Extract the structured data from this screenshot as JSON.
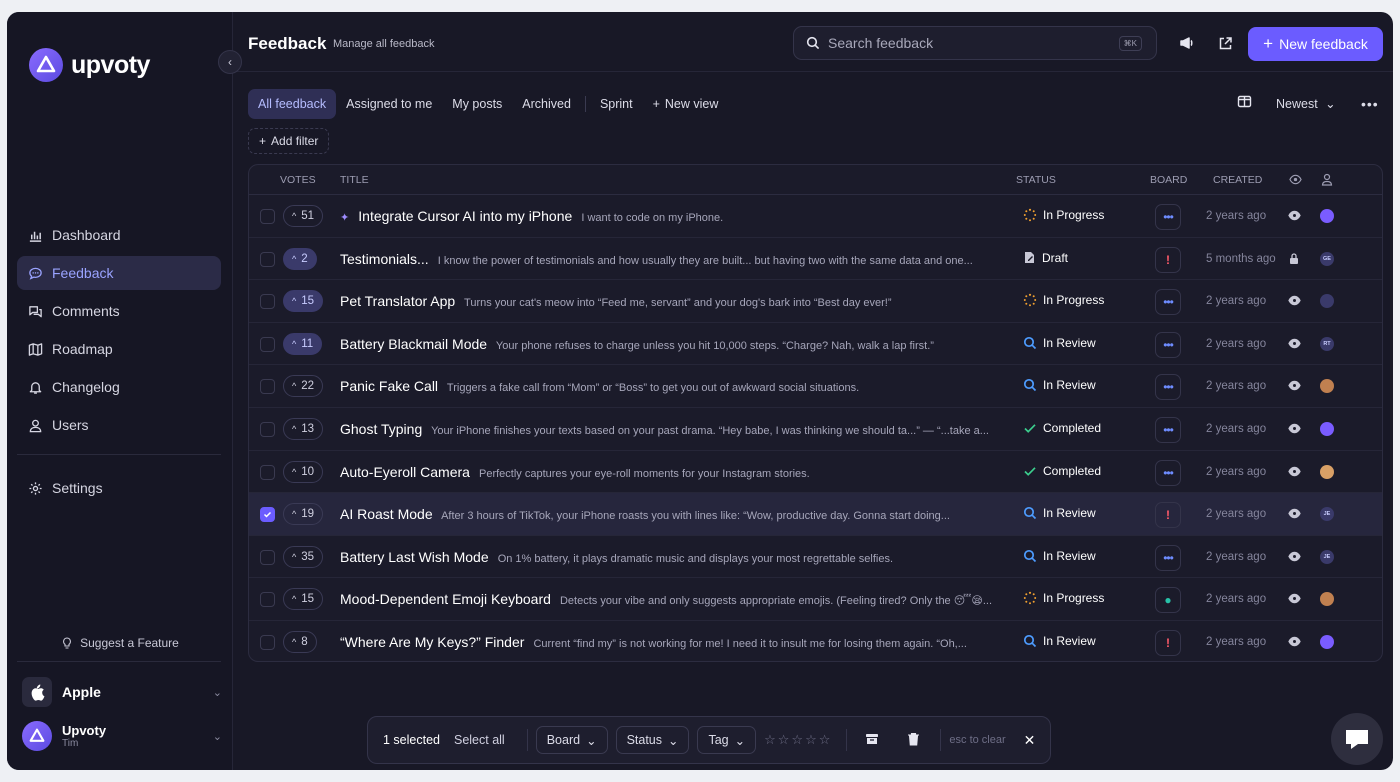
{
  "app": {
    "logo": "upvoty"
  },
  "sidebar": {
    "items": [
      {
        "label": "Dashboard",
        "icon": "bar-chart-icon",
        "active": false
      },
      {
        "label": "Feedback",
        "icon": "chat-bubble-icon",
        "active": true
      },
      {
        "label": "Comments",
        "icon": "comments-icon",
        "active": false
      },
      {
        "label": "Roadmap",
        "icon": "map-icon",
        "active": false
      },
      {
        "label": "Changelog",
        "icon": "bell-icon",
        "active": false
      },
      {
        "label": "Users",
        "icon": "user-icon",
        "active": false
      }
    ],
    "settings": "Settings",
    "suggest": "Suggest a Feature",
    "workspace": "Apple",
    "user_name": "Upvoty",
    "user_sub": "Tim"
  },
  "header": {
    "title": "Feedback",
    "subtitle": "Manage all feedback",
    "search_placeholder": "Search feedback",
    "search_shortcut": "⌘K",
    "new_button": "New feedback",
    "accent": "#6b5cff"
  },
  "tabs": [
    "All feedback",
    "Assigned to me",
    "My posts",
    "Archived",
    "Sprint",
    "New view"
  ],
  "sort_label": "Newest",
  "add_filter": "Add filter",
  "columns": {
    "votes": "VOTES",
    "title": "TITLE",
    "status": "STATUS",
    "board": "BOARD",
    "created": "CREATED"
  },
  "rows": [
    {
      "votes": "51",
      "filled": false,
      "pinned": true,
      "title": "Integrate Cursor AI into my iPhone",
      "desc": "I want to code on my iPhone.",
      "status": "In Progress",
      "status_icon": "progress-icon",
      "board": "dots",
      "created": "2 years ago",
      "vis": "eye-icon",
      "avatar": "",
      "selected": false
    },
    {
      "votes": "2",
      "filled": true,
      "pinned": false,
      "title": "Testimonials...",
      "desc": "I know the power of testimonials and how usually they are built... but having two with the same data and one...",
      "status": "Draft",
      "status_icon": "draft-icon",
      "board": "alert",
      "created": "5 months ago",
      "vis": "lock-icon",
      "avatar": "GE",
      "selected": false
    },
    {
      "votes": "15",
      "filled": true,
      "pinned": false,
      "title": "Pet Translator App",
      "desc": "Turns your cat's meow into “Feed me, servant” and your dog's bark into “Best day ever!”",
      "status": "In Progress",
      "status_icon": "progress-icon",
      "board": "dots",
      "created": "2 years ago",
      "vis": "eye-icon",
      "avatar": "",
      "selected": false
    },
    {
      "votes": "11",
      "filled": true,
      "pinned": false,
      "title": "Battery Blackmail Mode",
      "desc": "Your phone refuses to charge unless you hit 10,000 steps. “Charge? Nah, walk a lap first.”",
      "status": "In Review",
      "status_icon": "search-icon",
      "board": "dots",
      "created": "2 years ago",
      "vis": "eye-icon",
      "avatar": "RT",
      "selected": false
    },
    {
      "votes": "22",
      "filled": false,
      "pinned": false,
      "title": "Panic Fake Call",
      "desc": "Triggers a fake call from “Mom” or “Boss” to get you out of awkward social situations.",
      "status": "In Review",
      "status_icon": "search-icon",
      "board": "dots",
      "created": "2 years ago",
      "vis": "eye-icon",
      "avatar": "",
      "selected": false
    },
    {
      "votes": "13",
      "filled": false,
      "pinned": false,
      "title": "Ghost Typing",
      "desc": "Your iPhone finishes your texts based on your past drama. “Hey babe, I was thinking we should ta...” — “...take a...",
      "status": "Completed",
      "status_icon": "check-icon",
      "board": "dots",
      "created": "2 years ago",
      "vis": "eye-icon",
      "avatar": "",
      "selected": false
    },
    {
      "votes": "10",
      "filled": false,
      "pinned": false,
      "title": "Auto-Eyeroll Camera",
      "desc": "Perfectly captures your eye-roll moments for your Instagram stories.",
      "status": "Completed",
      "status_icon": "check-icon",
      "board": "dots",
      "created": "2 years ago",
      "vis": "eye-icon",
      "avatar": "",
      "selected": false
    },
    {
      "votes": "19",
      "filled": false,
      "pinned": false,
      "title": "AI Roast Mode",
      "desc": "After 3 hours of TikTok, your iPhone roasts you with lines like: “Wow, productive day. Gonna start doing...",
      "status": "In Review",
      "status_icon": "search-icon",
      "board": "alert",
      "created": "2 years ago",
      "vis": "eye-icon",
      "avatar": "JE",
      "selected": true
    },
    {
      "votes": "35",
      "filled": false,
      "pinned": false,
      "title": "Battery Last Wish Mode",
      "desc": "On 1% battery, it plays dramatic music and displays your most regrettable selfies.",
      "status": "In Review",
      "status_icon": "search-icon",
      "board": "dots",
      "created": "2 years ago",
      "vis": "eye-icon",
      "avatar": "JE",
      "selected": false
    },
    {
      "votes": "15",
      "filled": false,
      "pinned": false,
      "title": "Mood-Dependent Emoji Keyboard",
      "desc": "Detects your vibe and only suggests appropriate emojis. (Feeling tired? Only the 😴😪...",
      "status": "In Progress",
      "status_icon": "progress-icon",
      "board": "bulb",
      "created": "2 years ago",
      "vis": "eye-icon",
      "avatar": "",
      "selected": false
    },
    {
      "votes": "8",
      "filled": false,
      "pinned": false,
      "title": "“Where Are My Keys?” Finder",
      "desc": "Current “find my” is not working for me! I need it to insult me for losing them again. “Oh,...",
      "status": "In Review",
      "status_icon": "search-icon",
      "board": "alert",
      "created": "2 years ago",
      "vis": "eye-icon",
      "avatar": "",
      "selected": false
    }
  ],
  "bulk": {
    "selected": "1 selected",
    "select_all": "Select all",
    "board": "Board",
    "status": "Status",
    "tag": "Tag",
    "esc": "esc to clear"
  }
}
